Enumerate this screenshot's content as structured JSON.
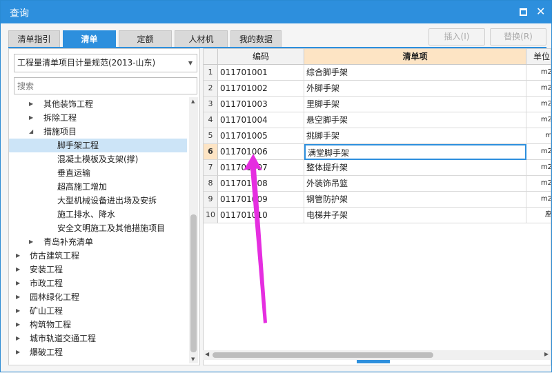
{
  "window": {
    "title": "查询"
  },
  "tabs": [
    {
      "label": "清单指引"
    },
    {
      "label": "清单"
    },
    {
      "label": "定额"
    },
    {
      "label": "人材机"
    },
    {
      "label": "我的数据"
    }
  ],
  "actions": {
    "insert_label": "插入(I)",
    "replace_label": "替换(R)"
  },
  "left": {
    "spec_value": "工程量清单项目计量规范(2013-山东)",
    "search_placeholder": "搜索",
    "tree": [
      {
        "label": "其他装饰工程"
      },
      {
        "label": "拆除工程"
      },
      {
        "label": "措施项目"
      },
      {
        "label": "脚手架工程"
      },
      {
        "label": "混凝土模板及支架(撑)"
      },
      {
        "label": "垂直运输"
      },
      {
        "label": "超高施工增加"
      },
      {
        "label": "大型机械设备进出场及安拆"
      },
      {
        "label": "施工排水、降水"
      },
      {
        "label": "安全文明施工及其他措施项目"
      },
      {
        "label": "青岛补充清单"
      },
      {
        "label": "仿古建筑工程"
      },
      {
        "label": "安装工程"
      },
      {
        "label": "市政工程"
      },
      {
        "label": "园林绿化工程"
      },
      {
        "label": "矿山工程"
      },
      {
        "label": "构筑物工程"
      },
      {
        "label": "城市轨道交通工程"
      },
      {
        "label": "爆破工程"
      }
    ]
  },
  "grid": {
    "headers": {
      "code": "编码",
      "item": "清单项",
      "unit": "单位"
    },
    "rows": [
      {
        "num": "1",
        "code": "011701001",
        "item": "综合脚手架",
        "unit": "m2"
      },
      {
        "num": "2",
        "code": "011701002",
        "item": "外脚手架",
        "unit": "m2"
      },
      {
        "num": "3",
        "code": "011701003",
        "item": "里脚手架",
        "unit": "m2"
      },
      {
        "num": "4",
        "code": "011701004",
        "item": "悬空脚手架",
        "unit": "m2"
      },
      {
        "num": "5",
        "code": "011701005",
        "item": "挑脚手架",
        "unit": "m"
      },
      {
        "num": "6",
        "code": "011701006",
        "item": "满堂脚手架",
        "unit": "m2"
      },
      {
        "num": "7",
        "code": "011701007",
        "item": "整体提升架",
        "unit": "m2"
      },
      {
        "num": "8",
        "code": "011701008",
        "item": "外装饰吊篮",
        "unit": "m2"
      },
      {
        "num": "9",
        "code": "011701009",
        "item": "钢管防护架",
        "unit": "m2"
      },
      {
        "num": "10",
        "code": "011701010",
        "item": "电梯井子架",
        "unit": "座"
      }
    ]
  },
  "colors": {
    "accent": "#2d8fdd",
    "header_highlight": "#fde4c4",
    "annotation_arrow": "#e52ee0"
  }
}
